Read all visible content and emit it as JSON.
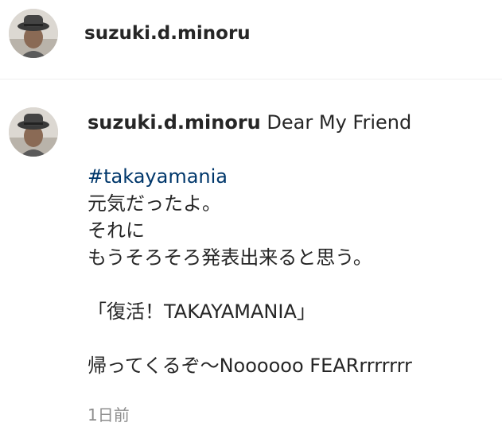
{
  "header": {
    "username": "suzuki.d.minoru"
  },
  "comment": {
    "username": "suzuki.d.minoru",
    "first_line": "Dear My Friend",
    "hashtag": "#takayamania",
    "lines": [
      "元気だったよ。",
      "それに",
      "もうそろそろ発表出来ると思う。",
      "",
      "「復活！TAKAYAMANIA」",
      "",
      "帰ってくるぞ〜Noooooo FEARrrrrrrr"
    ],
    "timestamp": "1日前"
  },
  "colors": {
    "text": "#262626",
    "hashtag": "#00376b",
    "timestamp": "#8e8e8e",
    "divider": "#efefef"
  },
  "icons": {
    "avatar": "profile-photo-man-in-hat"
  }
}
